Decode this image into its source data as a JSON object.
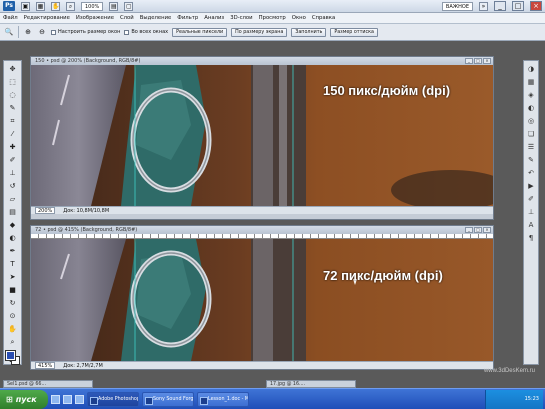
{
  "appbar": {
    "logo": "Ps",
    "zoom": "100%",
    "workspace": "ВАЖНОЕ",
    "window_controls": [
      "_",
      "□",
      "×"
    ]
  },
  "menu": {
    "items": [
      "Файл",
      "Редактирование",
      "Изображение",
      "Слой",
      "Выделение",
      "Фильтр",
      "Анализ",
      "3D-слои",
      "Просмотр",
      "Окно",
      "Справка"
    ]
  },
  "options": {
    "resize_windows": "Настроить размер окон",
    "all_windows": "Во всех окнах",
    "actual_pixels": "Реальные пиксели",
    "fit_screen": "По размеру экрана",
    "fill_screen": "Заполнить",
    "print_size": "Размер оттиска"
  },
  "docs": [
    {
      "title": "150 • psd @ 200% (Background, RGB/8#)",
      "dpi_label": "150 пикс/дюйм (dpi)",
      "zoom": "200%",
      "status": "Док: 10,8M/10,8M"
    },
    {
      "title": "72 • psd @ 415% (Background, RGB/8#)",
      "dpi_label": "72 пикс/дюйм (dpi)",
      "zoom": "415%",
      "status": "Док: 2,7M/2,7M"
    }
  ],
  "minimized": [
    "Sel1.psd @ 66...",
    "17.jpg @ 16...."
  ],
  "watermark": "www.3dDesKem.ru",
  "taskbar": {
    "start": "пуск",
    "tasks": [
      "Adobe Photoshop CS...",
      "Sony Sound Forge P...",
      "Lesson_1.doc - Micro..."
    ],
    "time": "15:23"
  },
  "colors": {
    "foreground_swatch": "#2a4db0",
    "taskbar": "#2452c0",
    "start_button": "#3e963a"
  }
}
